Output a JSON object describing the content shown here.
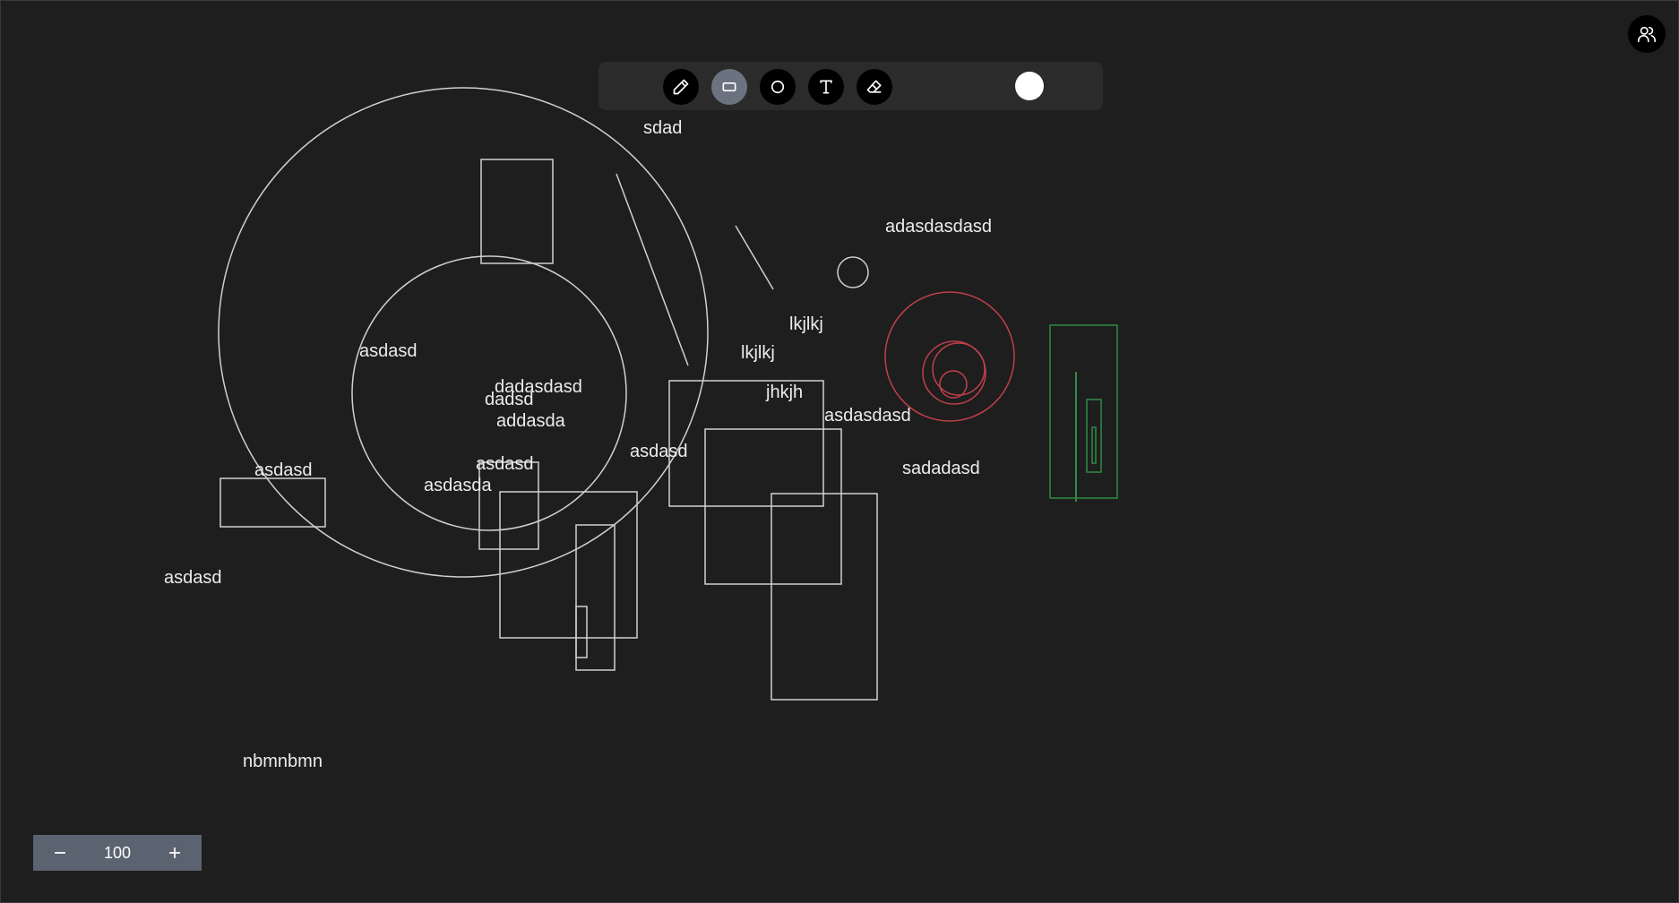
{
  "toolbar": {
    "tools": [
      {
        "name": "pencil-icon",
        "active": false
      },
      {
        "name": "rectangle-icon",
        "active": true
      },
      {
        "name": "circle-icon",
        "active": false
      },
      {
        "name": "text-icon",
        "active": false
      },
      {
        "name": "eraser-icon",
        "active": false
      }
    ],
    "selected_color": "#ffffff"
  },
  "zoom": {
    "value": "100",
    "minus_icon": "minus-icon",
    "plus_icon": "plus-icon"
  },
  "users_icon": "users-icon",
  "canvas_texts": [
    "sdad",
    "adasdasdasd",
    "lkjlkj",
    "lkjlkj",
    "asdasd",
    "dadasdasd",
    "dadsd",
    "addasda",
    "jhkjh",
    "asdasdasd",
    "asdasd",
    "asdasd",
    "sadadasd",
    "asdasd",
    "asdasda",
    "asdasd",
    "nbmnbmn"
  ],
  "colors": {
    "background": "#1e1e1e",
    "stroke_default": "#d0d0d0",
    "stroke_red": "#c0404a",
    "stroke_green": "#2e8b45"
  }
}
